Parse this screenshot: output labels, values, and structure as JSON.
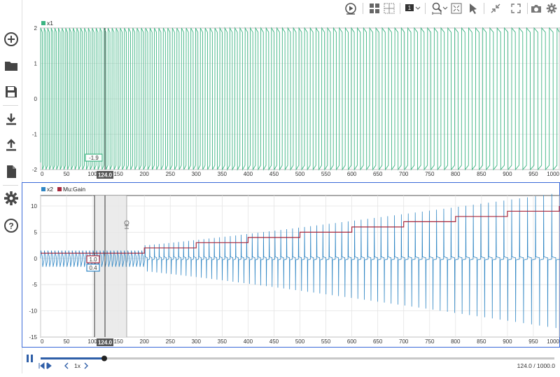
{
  "colors": {
    "signal_x1": "#3cb482",
    "signal_x2": "#2f86c4",
    "signal_gain": "#a8283c",
    "accent": "#3b6ad8"
  },
  "sidebar": {
    "items": [
      {
        "name": "add-icon"
      },
      {
        "name": "folder-icon"
      },
      {
        "name": "save-icon"
      },
      {
        "name": "download-icon"
      },
      {
        "name": "upload-icon"
      },
      {
        "name": "document-icon"
      },
      {
        "name": "settings-icon"
      },
      {
        "name": "help-icon"
      }
    ]
  },
  "toolbar": {
    "layout_number": "1"
  },
  "plot1": {
    "legend": [
      {
        "label": "x1",
        "color": "#3cb482"
      }
    ],
    "cursor_time": "124.0",
    "cursor_value": "-1.9"
  },
  "plot2": {
    "legend": [
      {
        "label": "x2",
        "color": "#2f86c4"
      },
      {
        "label": "Mu:Gain",
        "color": "#a8283c"
      }
    ],
    "cursor_time": "124.0",
    "cursor_value_gain": "1.0",
    "cursor_value_x2": "0.4"
  },
  "playback": {
    "speed": "1x",
    "time_readout": "124.0 / 1000.0",
    "progress": 0.124
  },
  "chart_data": [
    {
      "type": "line",
      "series": [
        {
          "name": "x1"
        }
      ],
      "xlim": [
        0,
        1000
      ],
      "ylim": [
        -2,
        2
      ],
      "xticks": [
        0,
        50,
        100,
        150,
        200,
        250,
        300,
        350,
        400,
        450,
        500,
        550,
        600,
        650,
        700,
        750,
        800,
        850,
        900,
        950,
        1000
      ],
      "yticks": [
        -2,
        -1,
        0,
        1,
        2
      ],
      "grid": true,
      "legend": "top-left",
      "description_values": {
        "amplitude": 2,
        "oscillation_period_start": 6.7,
        "oscillation_period_end": 15
      }
    },
    {
      "type": "line",
      "series": [
        {
          "name": "x2",
          "description": "relaxation oscillation with spike amplitude growing over time"
        },
        {
          "name": "Mu:Gain",
          "x": [
            0,
            100,
            200,
            300,
            400,
            500,
            600,
            700,
            800,
            900,
            1000
          ],
          "y": [
            1,
            1,
            2,
            3,
            4,
            5,
            6,
            7,
            8,
            9,
            10
          ]
        }
      ],
      "xlim": [
        0,
        1000
      ],
      "ylim": [
        -15,
        12
      ],
      "xticks": [
        0,
        50,
        100,
        150,
        200,
        250,
        300,
        350,
        400,
        450,
        500,
        550,
        600,
        650,
        700,
        750,
        800,
        850,
        900,
        950,
        1000
      ],
      "yticks": [
        -15,
        -10,
        -5,
        0,
        5,
        10
      ],
      "grid": true,
      "legend": "top-left"
    }
  ]
}
